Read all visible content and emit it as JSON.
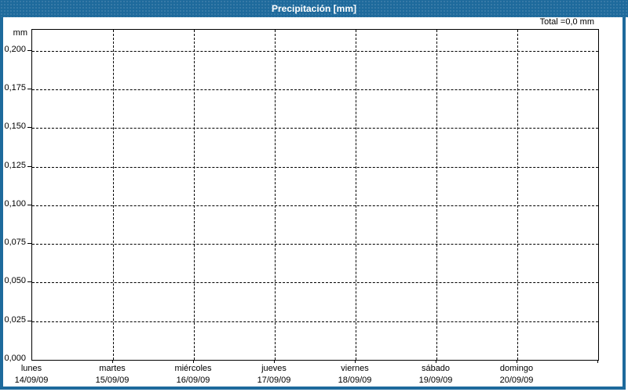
{
  "window": {
    "title": "Precipitación [mm]"
  },
  "colors": {
    "titlebar_bg": "#1E6A9C",
    "frame": "#1E6A9C",
    "plot_bg": "#FFFFFF",
    "grid": "#000000",
    "text": "#000000",
    "title_text": "#FFFFFF"
  },
  "chart_data": {
    "type": "bar",
    "title": "Precipitación [mm]",
    "subtitle": "",
    "total_annotation": "Total =0,0 mm",
    "y_unit": "mm",
    "xlabel": "",
    "ylabel": "mm",
    "ylim": [
      0,
      0.2135
    ],
    "grid": "dashed",
    "legend": "none",
    "categories": [
      {
        "day": "lunes",
        "date": "14/09/09"
      },
      {
        "day": "martes",
        "date": "15/09/09"
      },
      {
        "day": "miércoles",
        "date": "16/09/09"
      },
      {
        "day": "jueves",
        "date": "17/09/09"
      },
      {
        "day": "viernes",
        "date": "18/09/09"
      },
      {
        "day": "sábado",
        "date": "19/09/09"
      },
      {
        "day": "domingo",
        "date": "20/09/09"
      }
    ],
    "series": [
      {
        "name": "Precipitación",
        "values": [
          0,
          0,
          0,
          0,
          0,
          0,
          0
        ]
      }
    ],
    "y_ticks": [
      {
        "label": "0,200",
        "value": 0.2
      },
      {
        "label": "0,175",
        "value": 0.175
      },
      {
        "label": "0,150",
        "value": 0.15
      },
      {
        "label": "0,125",
        "value": 0.125
      },
      {
        "label": "0,100",
        "value": 0.1
      },
      {
        "label": "0,075",
        "value": 0.075
      },
      {
        "label": "0,050",
        "value": 0.05
      },
      {
        "label": "0,025",
        "value": 0.025
      },
      {
        "label": "0,000",
        "value": 0.0
      }
    ]
  }
}
